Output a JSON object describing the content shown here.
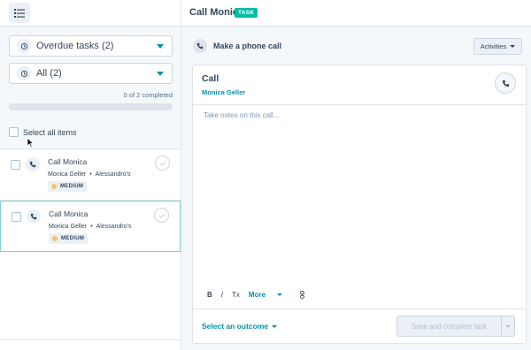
{
  "header": {
    "task_title": "Call Monica",
    "task_badge": "TASK"
  },
  "left_panel": {
    "queue_dropdown": "Overdue tasks (2)",
    "filter_dropdown": "All (2)",
    "completed_text": "0 of 2 completed",
    "progress_fraction": 0,
    "select_all_label": "Select all items",
    "tasks": [
      {
        "name": "Call Monica",
        "contact": "Monica Geller",
        "company": "Alessandro's",
        "priority": "MEDIUM",
        "selected": false
      },
      {
        "name": "Call Monica",
        "contact": "Monica Geller",
        "company": "Alessandro's",
        "priority": "MEDIUM",
        "selected": true
      }
    ]
  },
  "right_panel": {
    "phone_head_label": "Make a phone call",
    "activities_label": "Activities",
    "call": {
      "title": "Call",
      "contact": "Monica Geller",
      "notes_placeholder": "Take notes on this call...",
      "toolbar": {
        "bold": "B",
        "italic": "I",
        "clear_format": "Tx",
        "more": "More"
      },
      "outcome_label": "Select an outcome",
      "save_label": "Save and complete task"
    }
  },
  "colors": {
    "accent": "#0091ae",
    "badge": "#00bda5",
    "priority_medium": "#f5c26b",
    "selected_border": "#7fd1de"
  }
}
